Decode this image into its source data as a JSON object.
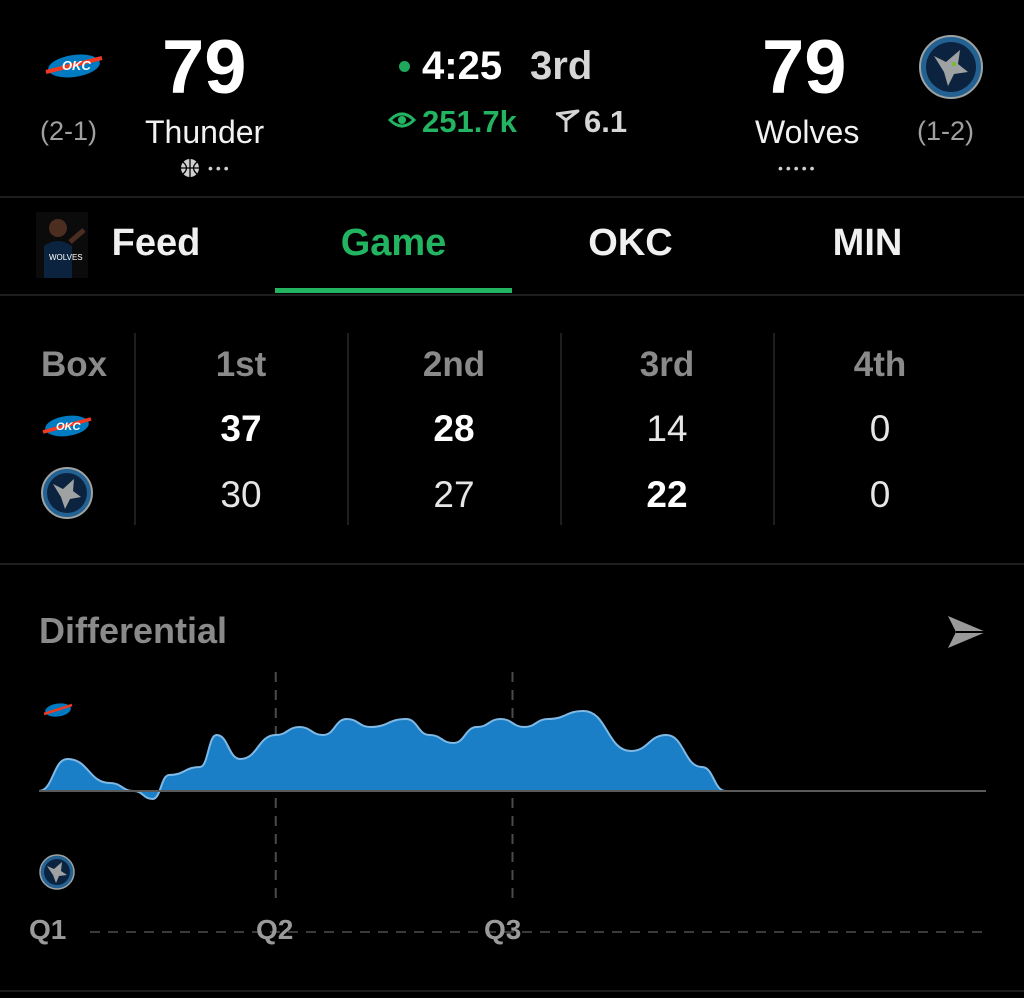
{
  "header": {
    "away": {
      "name": "Thunder",
      "score": "79",
      "record": "(2-1)",
      "abbr": "OKC",
      "dots": "•••"
    },
    "home": {
      "name": "Wolves",
      "score": "79",
      "record": "(1-2)",
      "dots": "•••••"
    },
    "clock": "4:25",
    "period": "3rd",
    "viewers": "251.7k",
    "rating": "6.1"
  },
  "tabs": [
    {
      "label": "Feed"
    },
    {
      "label": "Game",
      "active": true
    },
    {
      "label": "OKC"
    },
    {
      "label": "MIN"
    }
  ],
  "box": {
    "title": "Box",
    "periods": [
      "1st",
      "2nd",
      "3rd",
      "4th"
    ],
    "okc": [
      "37",
      "28",
      "14",
      "0"
    ],
    "min": [
      "30",
      "27",
      "22",
      "0"
    ]
  },
  "differential": {
    "title": "Differential",
    "quarters": [
      "Q1",
      "Q2",
      "Q3"
    ]
  },
  "chart_data": {
    "type": "area",
    "title": "Differential",
    "x_unit": "quarter",
    "xlim": [
      0,
      4
    ],
    "ylim": [
      -12,
      12
    ],
    "x": [
      0,
      0.12,
      0.3,
      0.4,
      0.48,
      0.55,
      0.68,
      0.75,
      0.85,
      1.0,
      1.1,
      1.2,
      1.3,
      1.4,
      1.55,
      1.65,
      1.75,
      1.85,
      1.95,
      2.05,
      2.15,
      2.3,
      2.5,
      2.65,
      2.8,
      2.9,
      3.0,
      3.1,
      3.2,
      3.3
    ],
    "values": [
      0,
      4,
      1,
      0,
      -1,
      2,
      3,
      7,
      4,
      7,
      8,
      7,
      9,
      8,
      9,
      7,
      6,
      8,
      9,
      8,
      9,
      10,
      5,
      7,
      3,
      0,
      0,
      0,
      0,
      0
    ],
    "series": [
      {
        "name": "Thunder",
        "color": "#1a7fc6"
      }
    ],
    "grid": false
  },
  "colors": {
    "accent": "#22b460",
    "okc_blue": "#007ac1",
    "okc_orange": "#ef3b24",
    "min_navy": "#0c2340",
    "min_blue": "#236192"
  },
  "icons": {
    "okc": "okc-thunder-logo",
    "min": "timberwolves-logo",
    "eye": "eye-icon",
    "rating": "rating-icon",
    "share": "share-arrow-icon",
    "avatar": "player-avatar"
  }
}
